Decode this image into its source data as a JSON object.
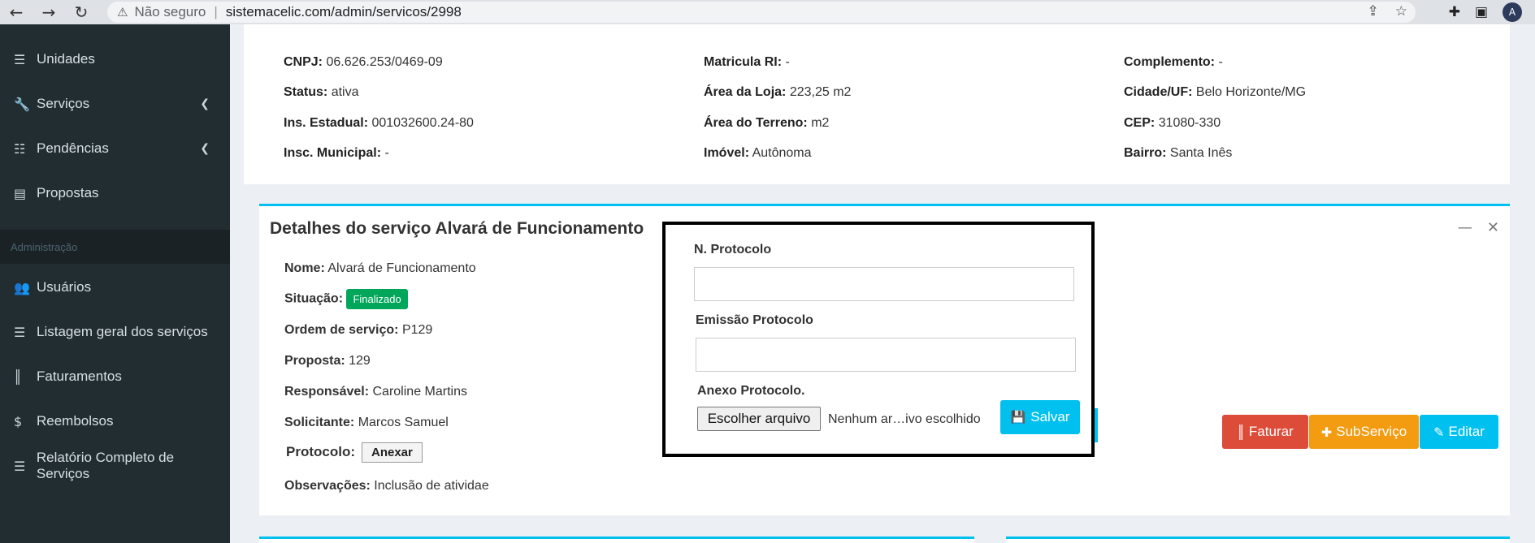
{
  "browser": {
    "back_icon": "arrow-left-icon",
    "forward_icon": "arrow-right-icon",
    "reload_icon": "reload-icon",
    "warning_icon": "warning-icon",
    "insecure_label": "Não seguro",
    "separator": "|",
    "url": "sistemacelic.com/admin/servicos/2998",
    "profile_initial": "A"
  },
  "sidebar": {
    "items": [
      {
        "label": "Unidades",
        "icon": "list-icon"
      },
      {
        "label": "Serviços",
        "icon": "wrench-icon"
      },
      {
        "label": "Pendências",
        "icon": "tasks-icon"
      },
      {
        "label": "Propostas",
        "icon": "table-icon"
      },
      {
        "label": "Usuários",
        "icon": "users-icon"
      },
      {
        "label": "Listagem geral dos serviços",
        "icon": "list-icon"
      },
      {
        "label": "Faturamentos",
        "icon": "barcode-icon"
      },
      {
        "label": "Reembolsos",
        "icon": "dollar-icon"
      },
      {
        "label": "Relatório Completo de Serviços",
        "icon": "list-icon"
      }
    ],
    "section_header": "Administração"
  },
  "info": {
    "col1": [
      {
        "label": "CNPJ:",
        "value": "06.626.253/0469-09"
      },
      {
        "label": "Status:",
        "value": "ativa"
      },
      {
        "label": "Ins. Estadual:",
        "value": "001032600.24-80"
      },
      {
        "label": "Insc. Municipal:",
        "value": "-"
      }
    ],
    "col2": [
      {
        "label": "Matricula RI:",
        "value": "-"
      },
      {
        "label": "Área da Loja:",
        "value": "223,25 m2"
      },
      {
        "label": "Área do Terreno:",
        "value": "m2"
      },
      {
        "label": "Imóvel:",
        "value": "Autônoma"
      }
    ],
    "col3": [
      {
        "label": "Complemento:",
        "value": "-"
      },
      {
        "label": "Cidade/UF:",
        "value": "Belo Horizonte/MG"
      },
      {
        "label": "CEP:",
        "value": "31080-330"
      },
      {
        "label": "Bairro:",
        "value": "Santa Inês"
      }
    ]
  },
  "details": {
    "title": "Detalhes do serviço Alvará de Funcionamento",
    "minimize_icon": "minus-icon",
    "close_icon": "close-icon",
    "nome_label": "Nome:",
    "nome_value": "Alvará de Funcionamento",
    "situacao_label": "Situação:",
    "situacao_badge": "Finalizado",
    "ordem_label": "Ordem de serviço:",
    "ordem_value": "P129",
    "proposta_label": "Proposta:",
    "proposta_value": "129",
    "responsavel_label": "Responsável:",
    "responsavel_value": "Caroline Martins",
    "solicitante_label": "Solicitante:",
    "solicitante_value": "Marcos Samuel",
    "protocolo_label": "Protocolo:",
    "anexar_label": "Anexar",
    "observacoes_label": "Observações:",
    "observacoes_value": "Inclusão de atividae"
  },
  "actions": {
    "faturar": "Faturar",
    "subservico": "SubServiço",
    "editar": "Editar"
  },
  "modal": {
    "protocolo_label": "N. Protocolo",
    "protocolo_value": "",
    "emissao_label": "Emissão Protocolo",
    "emissao_value": "",
    "anexo_label": "Anexo Protocolo.",
    "file_button": "Escolher arquivo",
    "file_status": "Nenhum ar…ivo escolhido",
    "salvar": "Salvar"
  },
  "colors": {
    "sidebar_bg": "#222d32",
    "accent": "#00c0ef",
    "success": "#00a65a",
    "danger": "#dd4b39",
    "warning": "#f39c12"
  }
}
